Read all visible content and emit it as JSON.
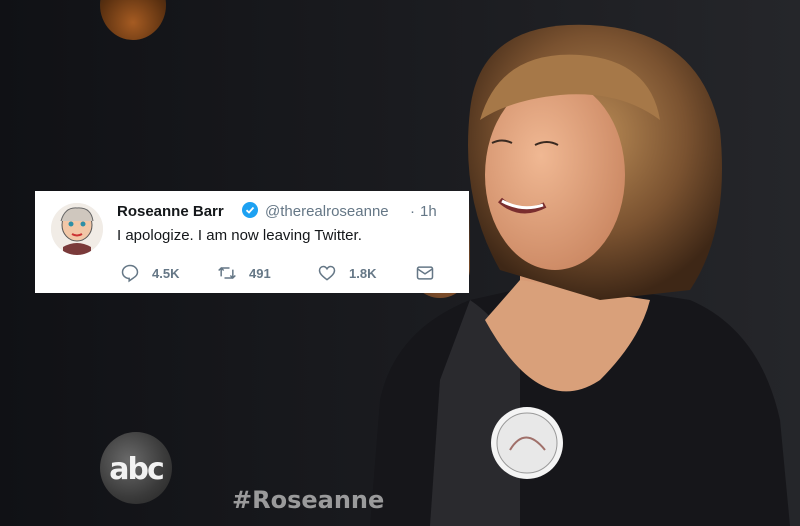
{
  "tweet": {
    "name": "Roseanne Barr",
    "handle": "@therealroseanne",
    "separator": "·",
    "time": "1h",
    "text": "I apologize. I am now leaving Twitter.",
    "replies": "4.5K",
    "retweets": "491",
    "likes": "1.8K"
  },
  "background": {
    "logo_bottom": "abc",
    "hashtag": "#Roseanne"
  },
  "colors": {
    "verified": "#1da1f2",
    "muted": "#657786",
    "text": "#14171a"
  }
}
